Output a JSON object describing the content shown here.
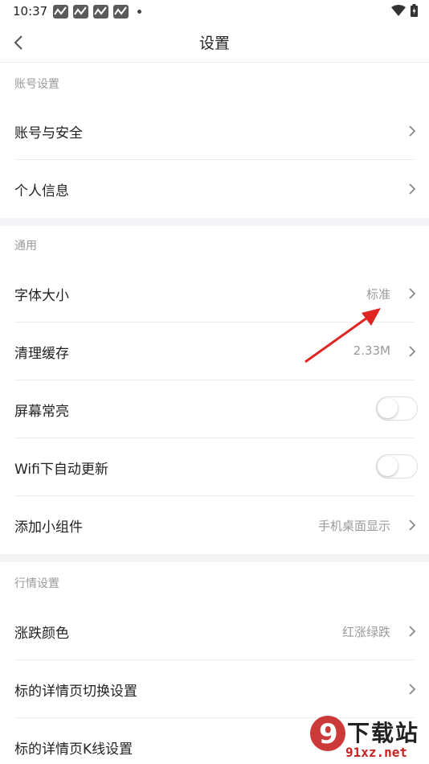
{
  "status_bar": {
    "time": "10:37"
  },
  "nav": {
    "title": "设置"
  },
  "sections": {
    "account": {
      "header": "账号设置",
      "rows": [
        {
          "label": "账号与安全"
        },
        {
          "label": "个人信息"
        }
      ]
    },
    "general": {
      "header": "通用",
      "rows": [
        {
          "label": "字体大小",
          "value": "标准"
        },
        {
          "label": "清理缓存",
          "value": "2.33M"
        },
        {
          "label": "屏幕常亮",
          "toggle": false
        },
        {
          "label": "Wifi下自动更新",
          "toggle": false
        },
        {
          "label": "添加小组件",
          "value": "手机桌面显示"
        }
      ]
    },
    "market": {
      "header": "行情设置",
      "rows": [
        {
          "label": "涨跌颜色",
          "value": "红涨绿跌"
        },
        {
          "label": "标的详情页切换设置"
        },
        {
          "label": "标的详情页K线设置"
        }
      ]
    }
  },
  "annotation": {
    "color": "#e02424"
  },
  "watermark": {
    "brand": "下载站",
    "url": "91xz.net",
    "logo": "9"
  },
  "colors": {
    "section_bg": "#f4f4f6",
    "secondary_text": "#9a9a9a",
    "watermark_red": "#c62323"
  }
}
